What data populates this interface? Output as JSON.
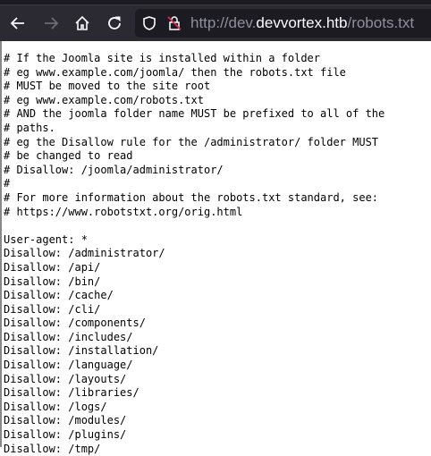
{
  "browser": {
    "url_prefix": "http://dev.",
    "url_domain": "devvortex.htb",
    "url_path": "/robots.txt"
  },
  "document": {
    "lines": [
      "# If the Joomla site is installed within a folder",
      "# eg www.example.com/joomla/ then the robots.txt file",
      "# MUST be moved to the site root",
      "# eg www.example.com/robots.txt",
      "# AND the joomla folder name MUST be prefixed to all of the",
      "# paths.",
      "# eg the Disallow rule for the /administrator/ folder MUST",
      "# be changed to read",
      "# Disallow: /joomla/administrator/",
      "#",
      "# For more information about the robots.txt standard, see:",
      "# https://www.robotstxt.org/orig.html",
      "",
      "User-agent: *",
      "Disallow: /administrator/",
      "Disallow: /api/",
      "Disallow: /bin/",
      "Disallow: /cache/",
      "Disallow: /cli/",
      "Disallow: /components/",
      "Disallow: /includes/",
      "Disallow: /installation/",
      "Disallow: /language/",
      "Disallow: /layouts/",
      "Disallow: /libraries/",
      "Disallow: /logs/",
      "Disallow: /modules/",
      "Disallow: /plugins/",
      "Disallow: /tmp/"
    ]
  }
}
